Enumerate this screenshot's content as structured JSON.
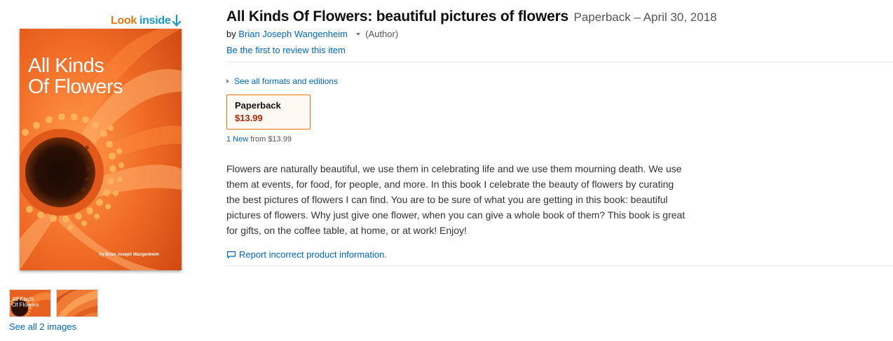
{
  "look_inside": {
    "word1": "Look",
    "word2": "inside"
  },
  "cover": {
    "title": "All Kinds\nOf Flowers",
    "author": "by Brian Joseph Wangenheim"
  },
  "thumbnails": [
    {
      "label": "All Kinds\nOf Flowers"
    },
    {
      "label": ""
    }
  ],
  "see_all_images": "See all 2 images",
  "product": {
    "title": "All Kinds Of Flowers: beautiful pictures of flowers",
    "binding_date": "Paperback – April 30, 2018",
    "by_prefix": "by",
    "author": "Brian Joseph Wangenheim",
    "author_role": "(Author)",
    "review_link": "Be the first to review this item"
  },
  "formats": {
    "see_all_label": "See all formats and editions",
    "selected": {
      "name": "Paperback",
      "price": "$13.99"
    },
    "offers_link": "1 New",
    "offers_suffix": "from $13.99"
  },
  "description": "Flowers are naturally beautiful, we use them in celebrating life and we use them mourning death. We use them at events, for food, for people, and more. In this book I celebrate the beauty of flowers by curating the best pictures of flowers I can find. You are to be sure of what you are getting in this book: beautiful pictures of flowers. Why just give one flower, when you can give a whole book of them? This book is great for gifts, on the coffee table, at home, or at work! Enjoy!",
  "report_link": "Report incorrect product information.",
  "colors": {
    "link": "#0066c0",
    "price": "#b12704",
    "selected_border": "#e77600",
    "look_orange": "#e47911",
    "look_blue": "#1a98c7"
  },
  "icons": [
    "look-inside-arrow-icon",
    "caret-down-icon",
    "triangle-right-icon",
    "speech-bubble-icon"
  ]
}
